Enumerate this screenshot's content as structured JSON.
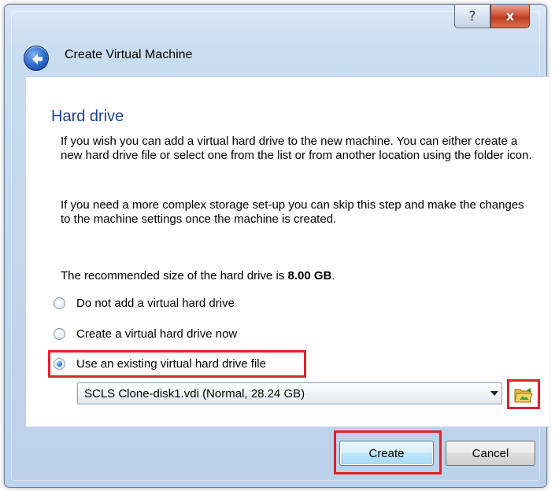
{
  "window": {
    "help_glyph": "?",
    "close_glyph": "x"
  },
  "header": {
    "title": "Create Virtual Machine",
    "back_icon": "back-arrow-icon"
  },
  "page": {
    "title": "Hard drive",
    "paragraph1": "If you wish you can add a virtual hard drive to the new machine. You can either create a new hard drive file or select one from the list or from another location using the folder icon.",
    "paragraph2": "If you need a more complex storage set-up you can skip this step and make the changes to the machine settings once the machine is created.",
    "recommended_prefix": "The recommended size of the hard drive is ",
    "recommended_size": "8.00 GB",
    "recommended_suffix": "."
  },
  "options": [
    {
      "label": "Do not add a virtual hard drive",
      "checked": false
    },
    {
      "label": "Create a virtual hard drive now",
      "checked": false
    },
    {
      "label": "Use an existing virtual hard drive file",
      "checked": true
    }
  ],
  "disk_select": {
    "value": "SCLS Clone-disk1.vdi (Normal, 28.24 GB)",
    "folder_icon": "folder-open-icon"
  },
  "buttons": {
    "create": "Create",
    "cancel": "Cancel"
  },
  "colors": {
    "page_title": "#1f3f9f",
    "highlight": "#e0222a"
  }
}
